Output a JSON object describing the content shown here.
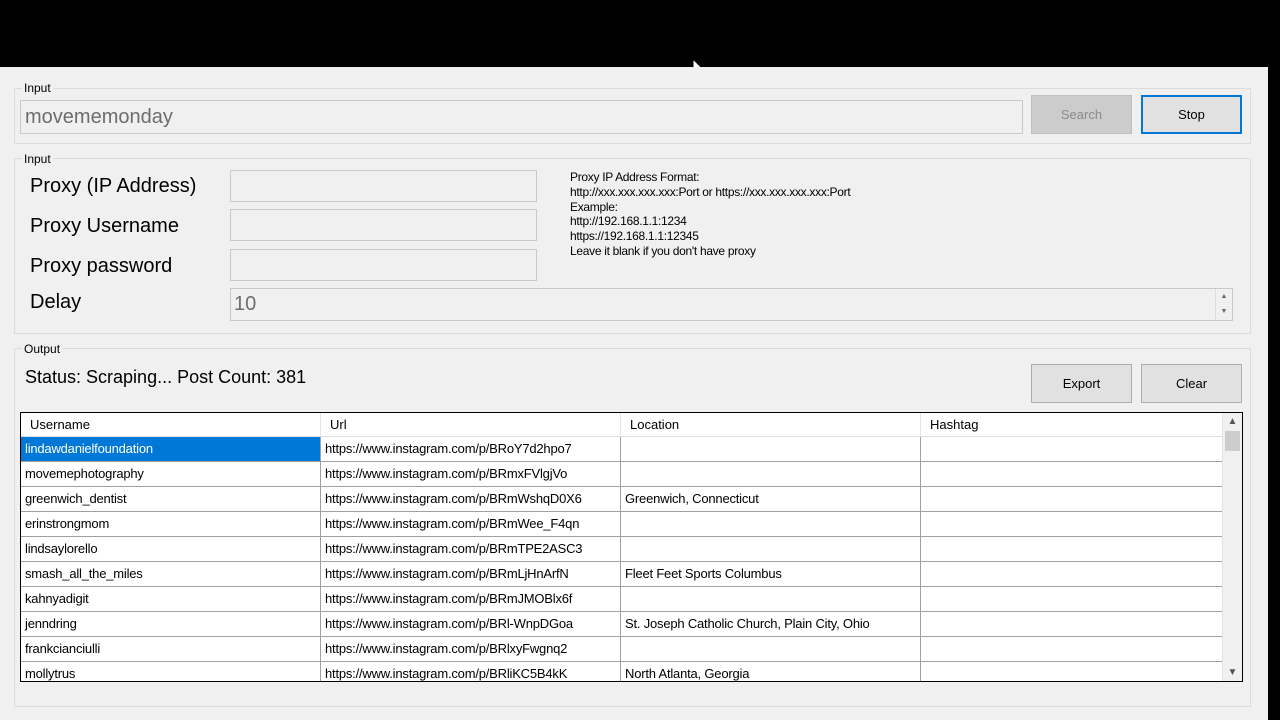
{
  "search_group": {
    "label": "Input",
    "query_value": "movememonday",
    "search_button": "Search",
    "stop_button": "Stop"
  },
  "proxy_group": {
    "label": "Input",
    "proxy_ip_label": "Proxy (IP Address)",
    "proxy_user_label": "Proxy Username",
    "proxy_pass_label": "Proxy password",
    "delay_label": "Delay",
    "proxy_ip_value": "",
    "proxy_user_value": "",
    "proxy_pass_value": "",
    "delay_value": "10",
    "help_lines": [
      "Proxy IP Address Format:",
      "http://xxx.xxx.xxx.xxx:Port or https://xxx.xxx.xxx.xxx:Port",
      "Example:",
      "http://192.168.1.1:1234",
      "https://192.168.1.1:12345",
      "Leave it blank if you don't have proxy"
    ]
  },
  "output_group": {
    "label": "Output",
    "status_text": "Status: Scraping... Post Count: 381",
    "export_button": "Export",
    "clear_button": "Clear"
  },
  "table": {
    "columns": [
      "Username",
      "Url",
      "Location",
      "Hashtag"
    ],
    "rows": [
      [
        "lindawdanielfoundation",
        "https://www.instagram.com/p/BRoY7d2hpo7",
        "",
        ""
      ],
      [
        "movemephotography",
        "https://www.instagram.com/p/BRmxFVlgjVo",
        "",
        ""
      ],
      [
        "greenwich_dentist",
        "https://www.instagram.com/p/BRmWshqD0X6",
        "Greenwich, Connecticut",
        ""
      ],
      [
        "erinstrongmom",
        "https://www.instagram.com/p/BRmWee_F4qn",
        "",
        ""
      ],
      [
        "lindsaylorello",
        "https://www.instagram.com/p/BRmTPE2ASC3",
        "",
        ""
      ],
      [
        "smash_all_the_miles",
        "https://www.instagram.com/p/BRmLjHnArfN",
        "Fleet Feet Sports Columbus",
        ""
      ],
      [
        "kahnyadigit",
        "https://www.instagram.com/p/BRmJMOBlx6f",
        "",
        ""
      ],
      [
        "jenndring",
        "https://www.instagram.com/p/BRl-WnpDGoa",
        "St. Joseph Catholic Church, Plain City, Ohio",
        ""
      ],
      [
        "frankcianciulli",
        "https://www.instagram.com/p/BRlxyFwgnq2",
        "",
        ""
      ],
      [
        "mollytrus",
        "https://www.instagram.com/p/BRliKC5B4kK",
        "North Atlanta, Georgia",
        ""
      ]
    ]
  },
  "colors": {
    "selection": "#0078d7",
    "window_bg": "#f0f0f0"
  }
}
